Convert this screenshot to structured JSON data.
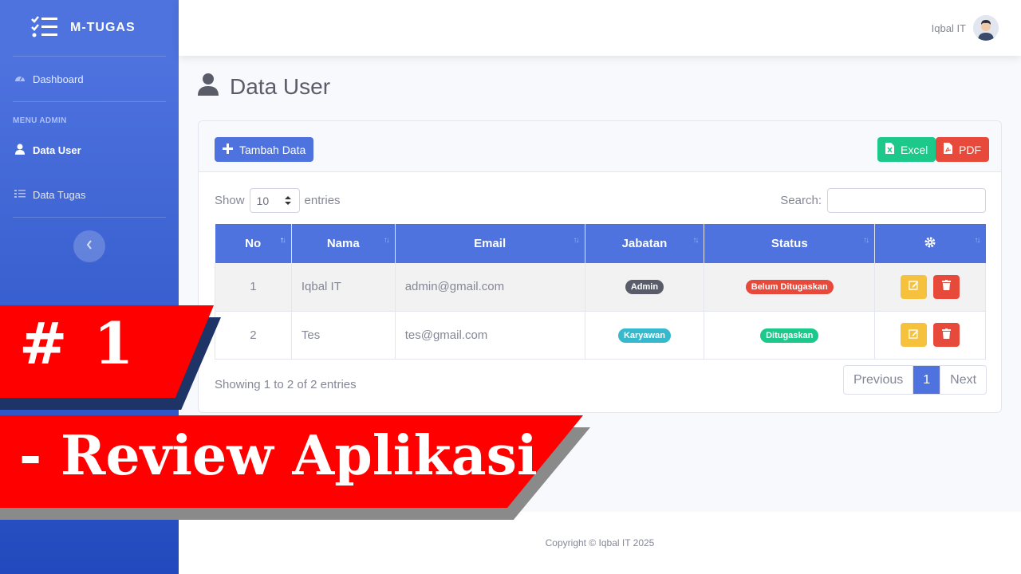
{
  "sidebar": {
    "brand": "M-TUGAS",
    "items": [
      {
        "label": "Dashboard",
        "icon": "tachometer-icon"
      },
      {
        "label": "Data User",
        "icon": "user-icon"
      },
      {
        "label": "Data Tugas",
        "icon": "list-check-icon"
      }
    ],
    "heading": "MENU ADMIN"
  },
  "topbar": {
    "user_name": "Iqbal IT"
  },
  "page": {
    "title": "Data User"
  },
  "card": {
    "add_label": "Tambah Data",
    "excel_label": "Excel",
    "pdf_label": "PDF"
  },
  "table_controls": {
    "show_label": "Show",
    "entries_label": "entries",
    "page_size": "10",
    "search_label": "Search:",
    "search_value": ""
  },
  "table": {
    "headers": [
      "No",
      "Nama",
      "Email",
      "Jabatan",
      "Status"
    ],
    "rows": [
      {
        "no": "1",
        "nama": "Iqbal IT",
        "email": "admin@gmail.com",
        "jabatan": "Admin",
        "status": "Belum Ditugaskan"
      },
      {
        "no": "2",
        "nama": "Tes",
        "email": "tes@gmail.com",
        "jabatan": "Karyawan",
        "status": "Ditugaskan"
      }
    ]
  },
  "pagination": {
    "info": "Showing 1 to 2 of 2 entries",
    "previous": "Previous",
    "current": "1",
    "next": "Next"
  },
  "footer": {
    "text": "Copyright © Iqbal IT 2025"
  },
  "overlay": {
    "episode": "# 1",
    "title": "- Review Aplikasi"
  },
  "colors": {
    "primary": "#4e73df",
    "success": "#1cc88a",
    "danger": "#e74a3b",
    "warning": "#f6c23e",
    "info": "#36b9cc",
    "overlay_red": "#ff0000"
  }
}
